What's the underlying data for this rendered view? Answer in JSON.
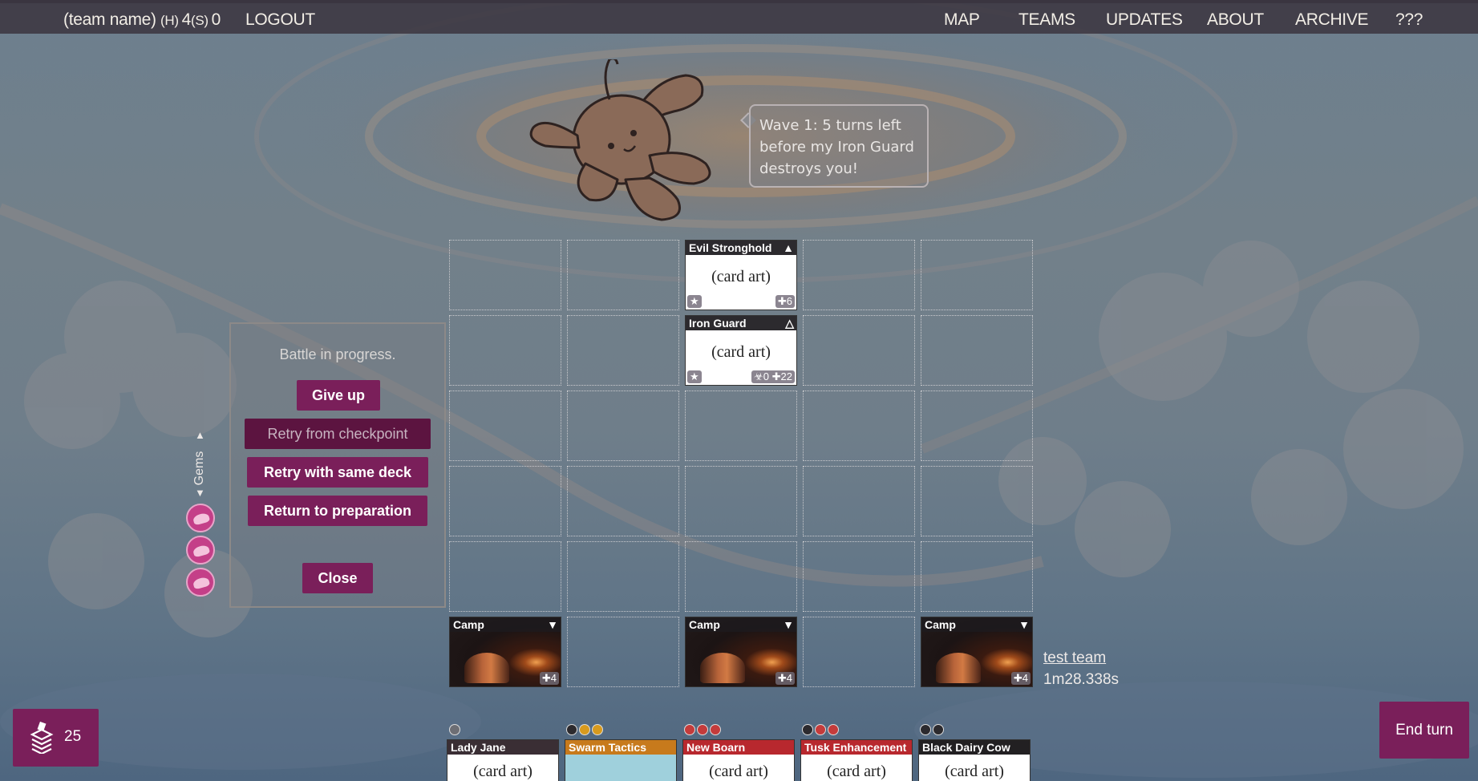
{
  "nav": {
    "team_name": "(team name)",
    "score_h": "(H)",
    "score_h_val": "4",
    "score_s": "(S)",
    "score_s_val": "0",
    "logout": "LOGOUT",
    "links": [
      "MAP",
      "TEAMS",
      "UPDATES",
      "ABOUT",
      "ARCHIVE",
      "???"
    ]
  },
  "boss": {
    "speech": "Wave 1: 5 turns left before my Iron Guard destroys you!"
  },
  "board": {
    "enemy_cards": [
      {
        "name": "Evil Stronghold",
        "art": "(card art)",
        "health": "6"
      },
      {
        "name": "Iron Guard",
        "art": "(card art)",
        "attack": "0",
        "health": "22"
      }
    ],
    "player_cards": [
      {
        "name": "Camp",
        "health": "4"
      },
      {
        "name": "Camp",
        "health": "4"
      },
      {
        "name": "Camp",
        "health": "4"
      }
    ]
  },
  "modal": {
    "status": "Battle in progress.",
    "give_up": "Give up",
    "retry_checkpoint": "Retry from checkpoint",
    "retry_same_deck": "Retry with same deck",
    "return_prep": "Return to preparation",
    "close": "Close"
  },
  "gems": {
    "label": "Gems",
    "count": 3
  },
  "team": {
    "name": "test team",
    "time": "1m28.338s"
  },
  "deck": {
    "count": "25"
  },
  "end_turn": "End turn",
  "hand": [
    {
      "name": "Lady Jane",
      "art": "(card art)",
      "header_color": "#3a2e34"
    },
    {
      "name": "Swarm Tactics",
      "art": "",
      "header_color": "#c77a1c"
    },
    {
      "name": "New Boarn",
      "art": "(card art)",
      "header_color": "#b8282e"
    },
    {
      "name": "Tusk Enhancement",
      "art": "(card art)",
      "header_color": "#b8282e"
    },
    {
      "name": "Black Dairy Cow",
      "art": "(card art)",
      "header_color": "#222022"
    }
  ],
  "colors": {
    "accent": "#7a1f5a",
    "nav_bg": "#3c3741",
    "gem": "#c43f88"
  }
}
